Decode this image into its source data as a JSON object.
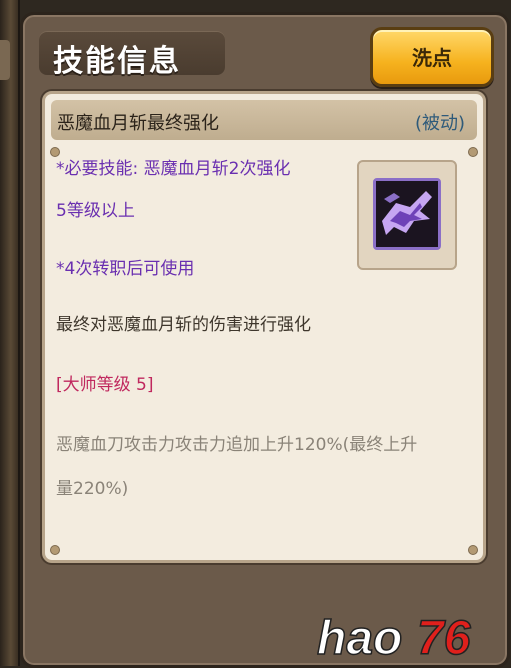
{
  "window": {
    "title": "技能信息",
    "reset_button": "洗点"
  },
  "skill": {
    "name": "恶魔血月斩最终强化",
    "type": "(被动)",
    "requirement_line1": "*必要技能: 恶魔血月斩2次强化",
    "requirement_line2": "5等级以上",
    "job_requirement": "*4次转职后可使用",
    "description": "最终对恶魔血月斩的伤害进行强化",
    "master_level": "[大师等级 5]",
    "effect_line1": "恶魔血刀攻击力攻击力追加上升120%(最终上升",
    "effect_line2": "量220%)",
    "icon": "demon-blade-skill-icon"
  },
  "watermark": {
    "text": "hao76"
  },
  "colors": {
    "requirement": "#6a2fb0",
    "master_level": "#c0285e",
    "effect": "#8a8378",
    "type": "#2e5a7a",
    "button": "#f6b21e"
  }
}
